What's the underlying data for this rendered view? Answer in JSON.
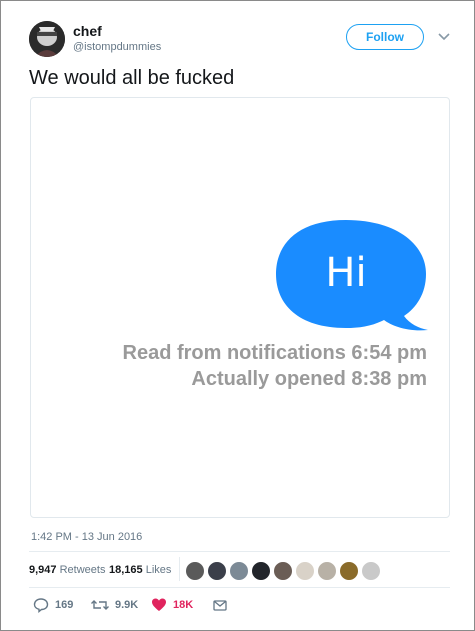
{
  "user": {
    "name": "chef",
    "handle": "@istompdummies",
    "follow_label": "Follow"
  },
  "tweet": {
    "text": "We would all be fucked"
  },
  "media": {
    "bubble_text": "Hi",
    "line1": "Read from notifications 6:54 pm",
    "line2": "Actually opened 8:38 pm",
    "bubble_color": "#1a8cff"
  },
  "meta": {
    "timestamp": "1:42 PM - 13 Jun 2016"
  },
  "stats": {
    "retweets_value": "9,947",
    "retweets_label": "Retweets",
    "likes_value": "18,165",
    "likes_label": "Likes",
    "liker_avatars": [
      "#5a5a5a",
      "#3b3f4a",
      "#7c8a96",
      "#22252b",
      "#6a5d55",
      "#d9d2c8",
      "#b8b1a6",
      "#8a6b2a",
      "#c9c9c9"
    ]
  },
  "actions": {
    "reply_count": "169",
    "retweet_count": "9.9K",
    "like_count": "18K",
    "like_color": "#e0245e"
  },
  "colors": {
    "accent": "#1da1f2",
    "muted": "#657786"
  }
}
